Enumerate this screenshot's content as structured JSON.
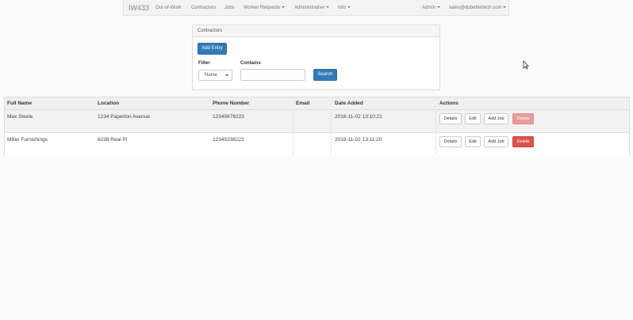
{
  "navbar": {
    "brand": "IW433",
    "items": [
      "Out-of-Work",
      "Contractors",
      "Jobs",
      "Worker Requests",
      "Administrative",
      "Info"
    ],
    "right_items": [
      "Admin",
      "sales@dobettertech.com"
    ]
  },
  "panel": {
    "heading": "Contractors",
    "add_entry": "Add Entry",
    "filter_label": "Filter",
    "filter_value": "Name",
    "contains_label": "Contains",
    "contains_value": "",
    "search_button": "Search"
  },
  "table": {
    "headers": [
      "Full Name",
      "Location",
      "Phone Number",
      "Email",
      "Date Added",
      "Actions"
    ],
    "rows": [
      {
        "name": "Max Steele",
        "location": "1234 Paperton Avenue",
        "phone": "12345678223",
        "email": "",
        "date": "2018-11-02 13:10:21"
      },
      {
        "name": "Miller Furnishings",
        "location": "6238 Real Pl",
        "phone": "12345338223",
        "email": "",
        "date": "2018-11-02 13:11:20"
      }
    ],
    "actions": {
      "details": "Details",
      "edit": "Edit",
      "add_job": "Add Job",
      "delete": "Delete"
    }
  },
  "colors": {
    "primary": "#337ab7",
    "danger": "#d9534f"
  }
}
